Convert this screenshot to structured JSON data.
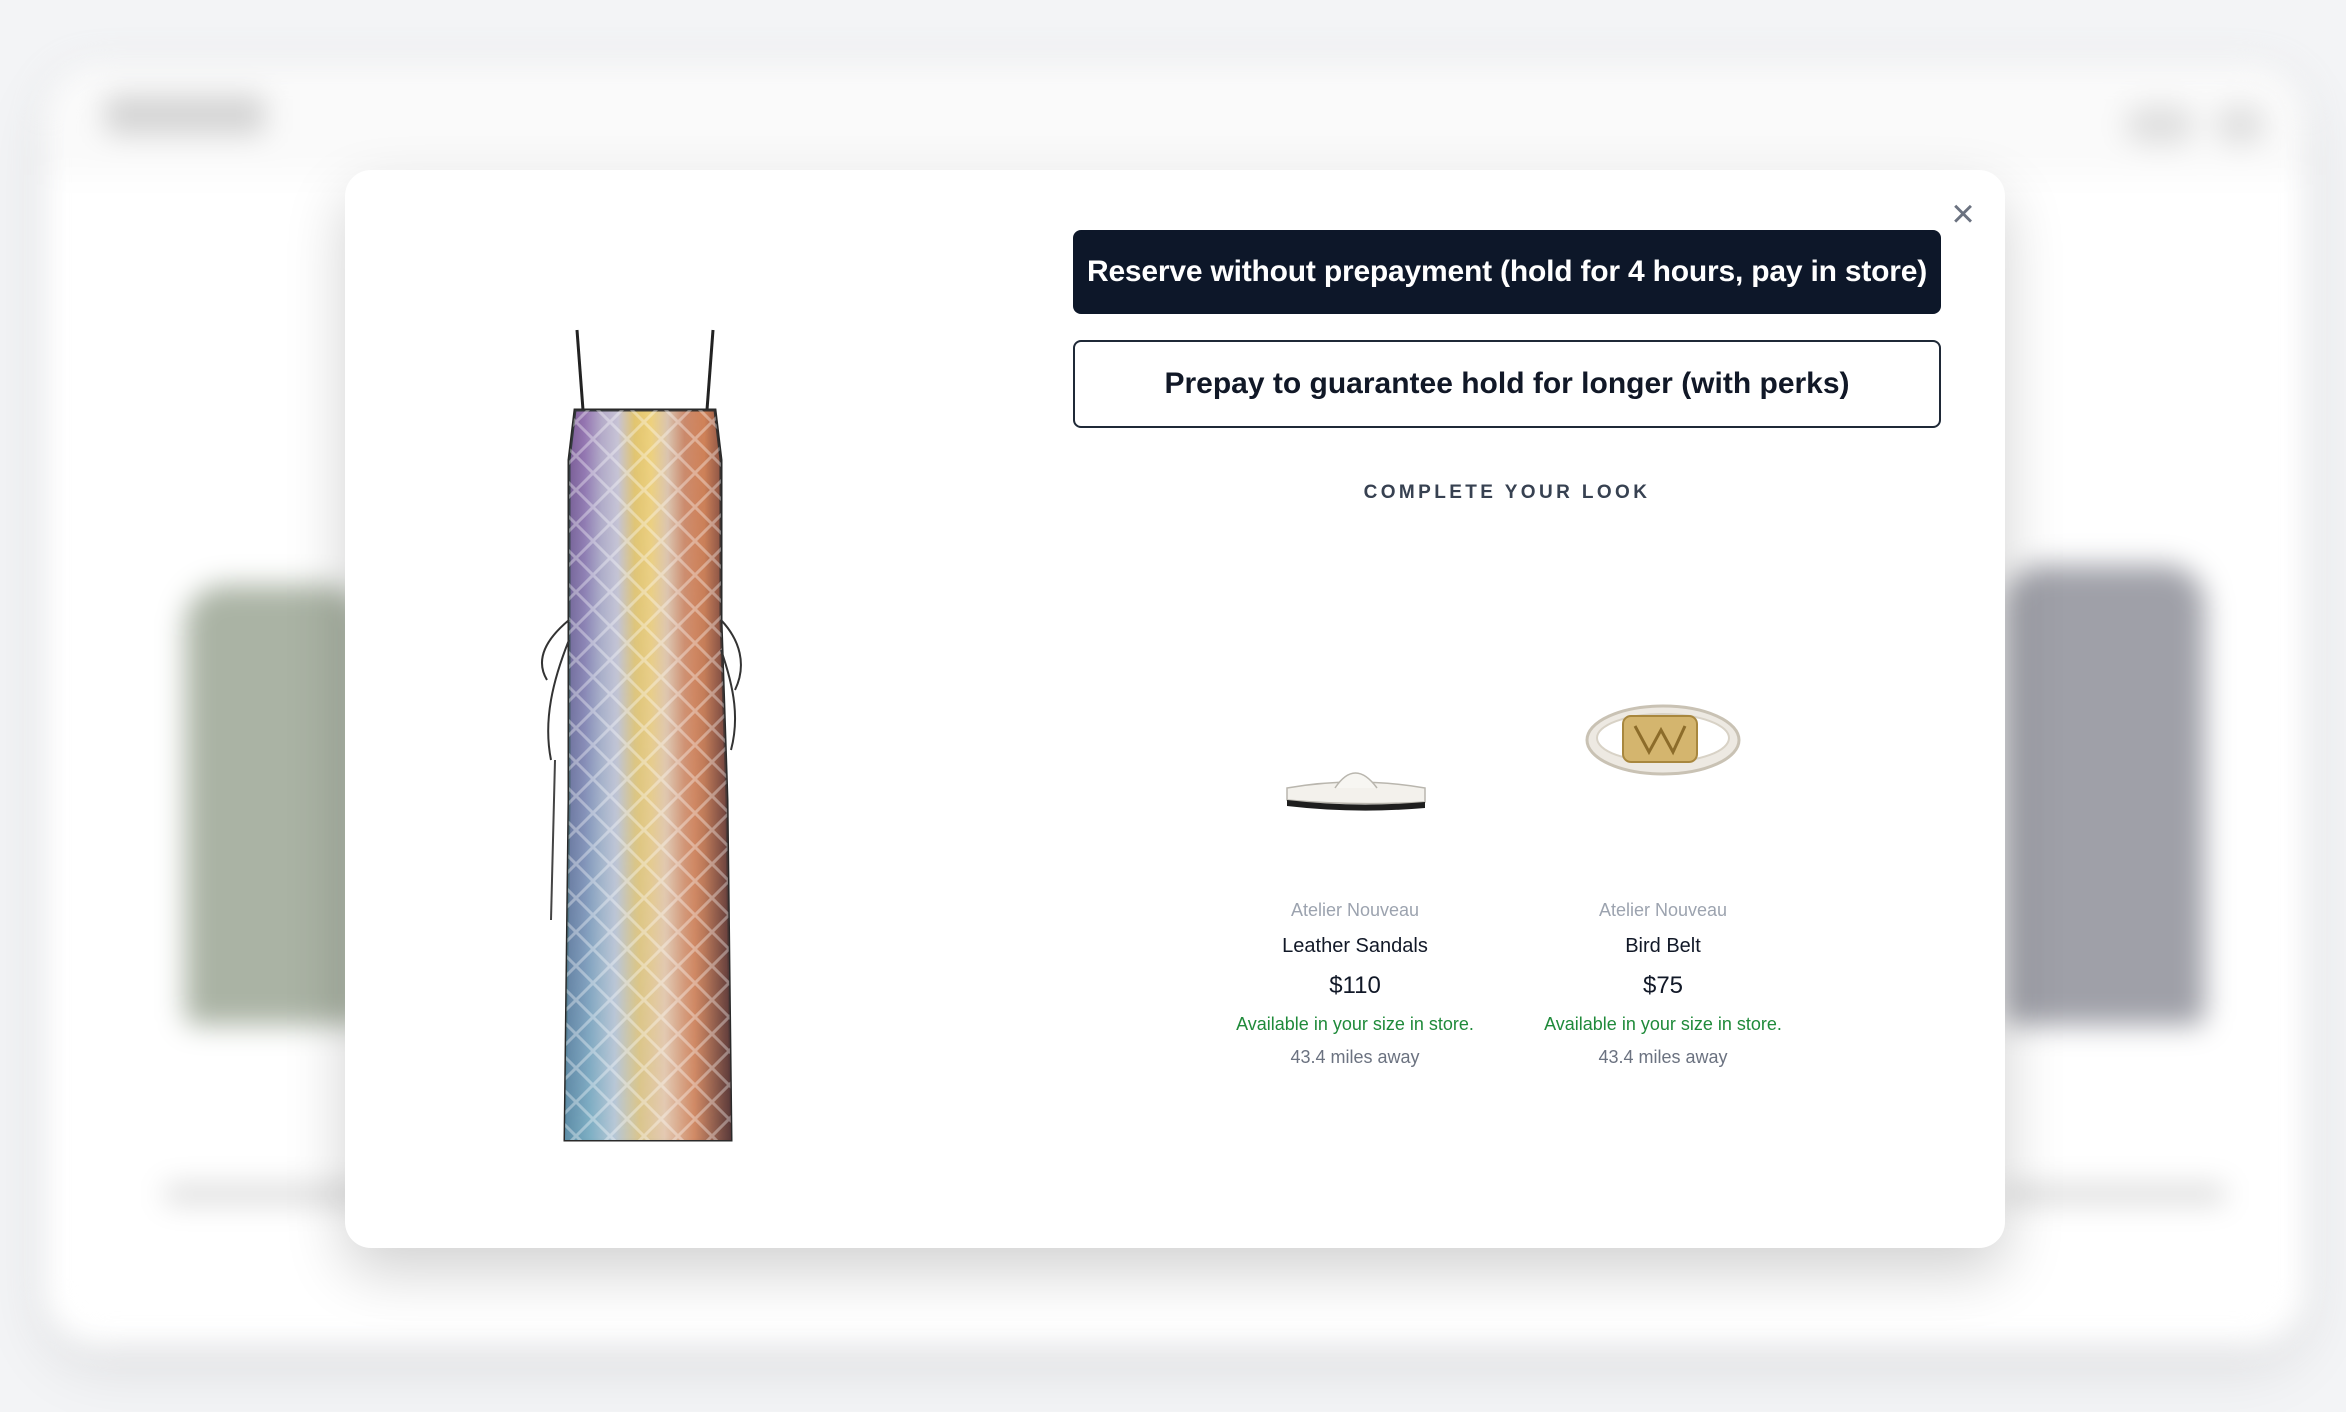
{
  "modal": {
    "close_label": "×",
    "primary_button": "Reserve without prepayment (hold for 4 hours, pay in store)",
    "secondary_button": "Prepay to guarantee hold for longer (with perks)",
    "section_title": "COMPLETE YOUR LOOK",
    "products": [
      {
        "icon": "sandal-icon",
        "brand": "Atelier Nouveau",
        "name": "Leather Sandals",
        "price": "$110",
        "availability": "Available in your size in store.",
        "distance": "43.4 miles away"
      },
      {
        "icon": "belt-icon",
        "brand": "Atelier Nouveau",
        "name": "Bird Belt",
        "price": "$75",
        "availability": "Available in your size in store.",
        "distance": "43.4 miles away"
      }
    ]
  },
  "colors": {
    "primary_button_bg": "#0d1729",
    "availability_text": "#1f8a3a"
  }
}
